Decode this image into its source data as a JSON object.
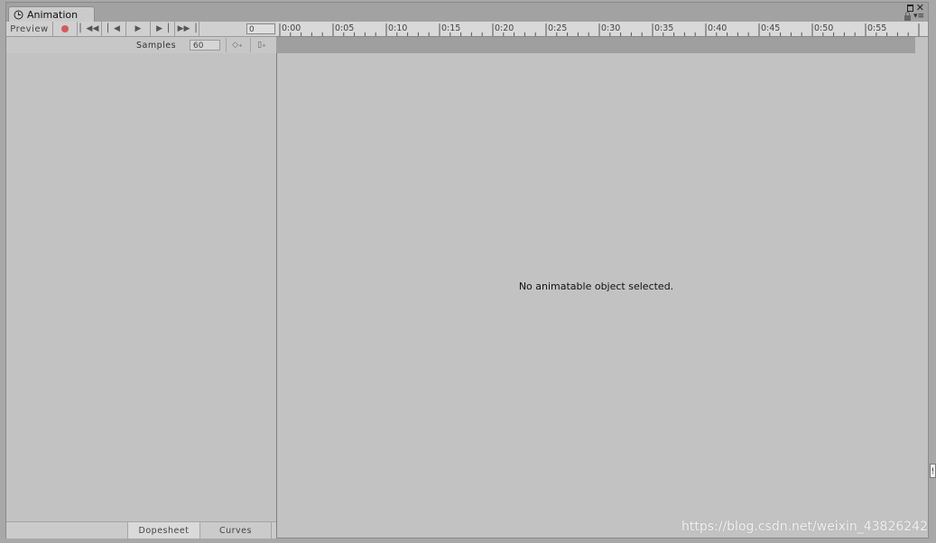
{
  "window": {
    "tab_title": "Animation"
  },
  "toolbar": {
    "preview_label": "Preview",
    "frame_value": "0",
    "controls": [
      "first-key",
      "prev-key",
      "play",
      "next-key",
      "last-key"
    ]
  },
  "ruler": {
    "labels": [
      "0:00",
      "0:05",
      "0:10",
      "0:15",
      "0:20",
      "0:25",
      "0:30",
      "0:35",
      "0:40",
      "0:45",
      "0:50",
      "0:55"
    ]
  },
  "samples": {
    "label": "Samples",
    "value": "60"
  },
  "main": {
    "message": "No animatable object selected."
  },
  "bottom_tabs": {
    "dopesheet": "Dopesheet",
    "curves": "Curves"
  },
  "watermark": "https://blog.csdn.net/weixin_43826242",
  "colors": {
    "record": "#d45a5a",
    "panel": "#c2c2c2"
  }
}
